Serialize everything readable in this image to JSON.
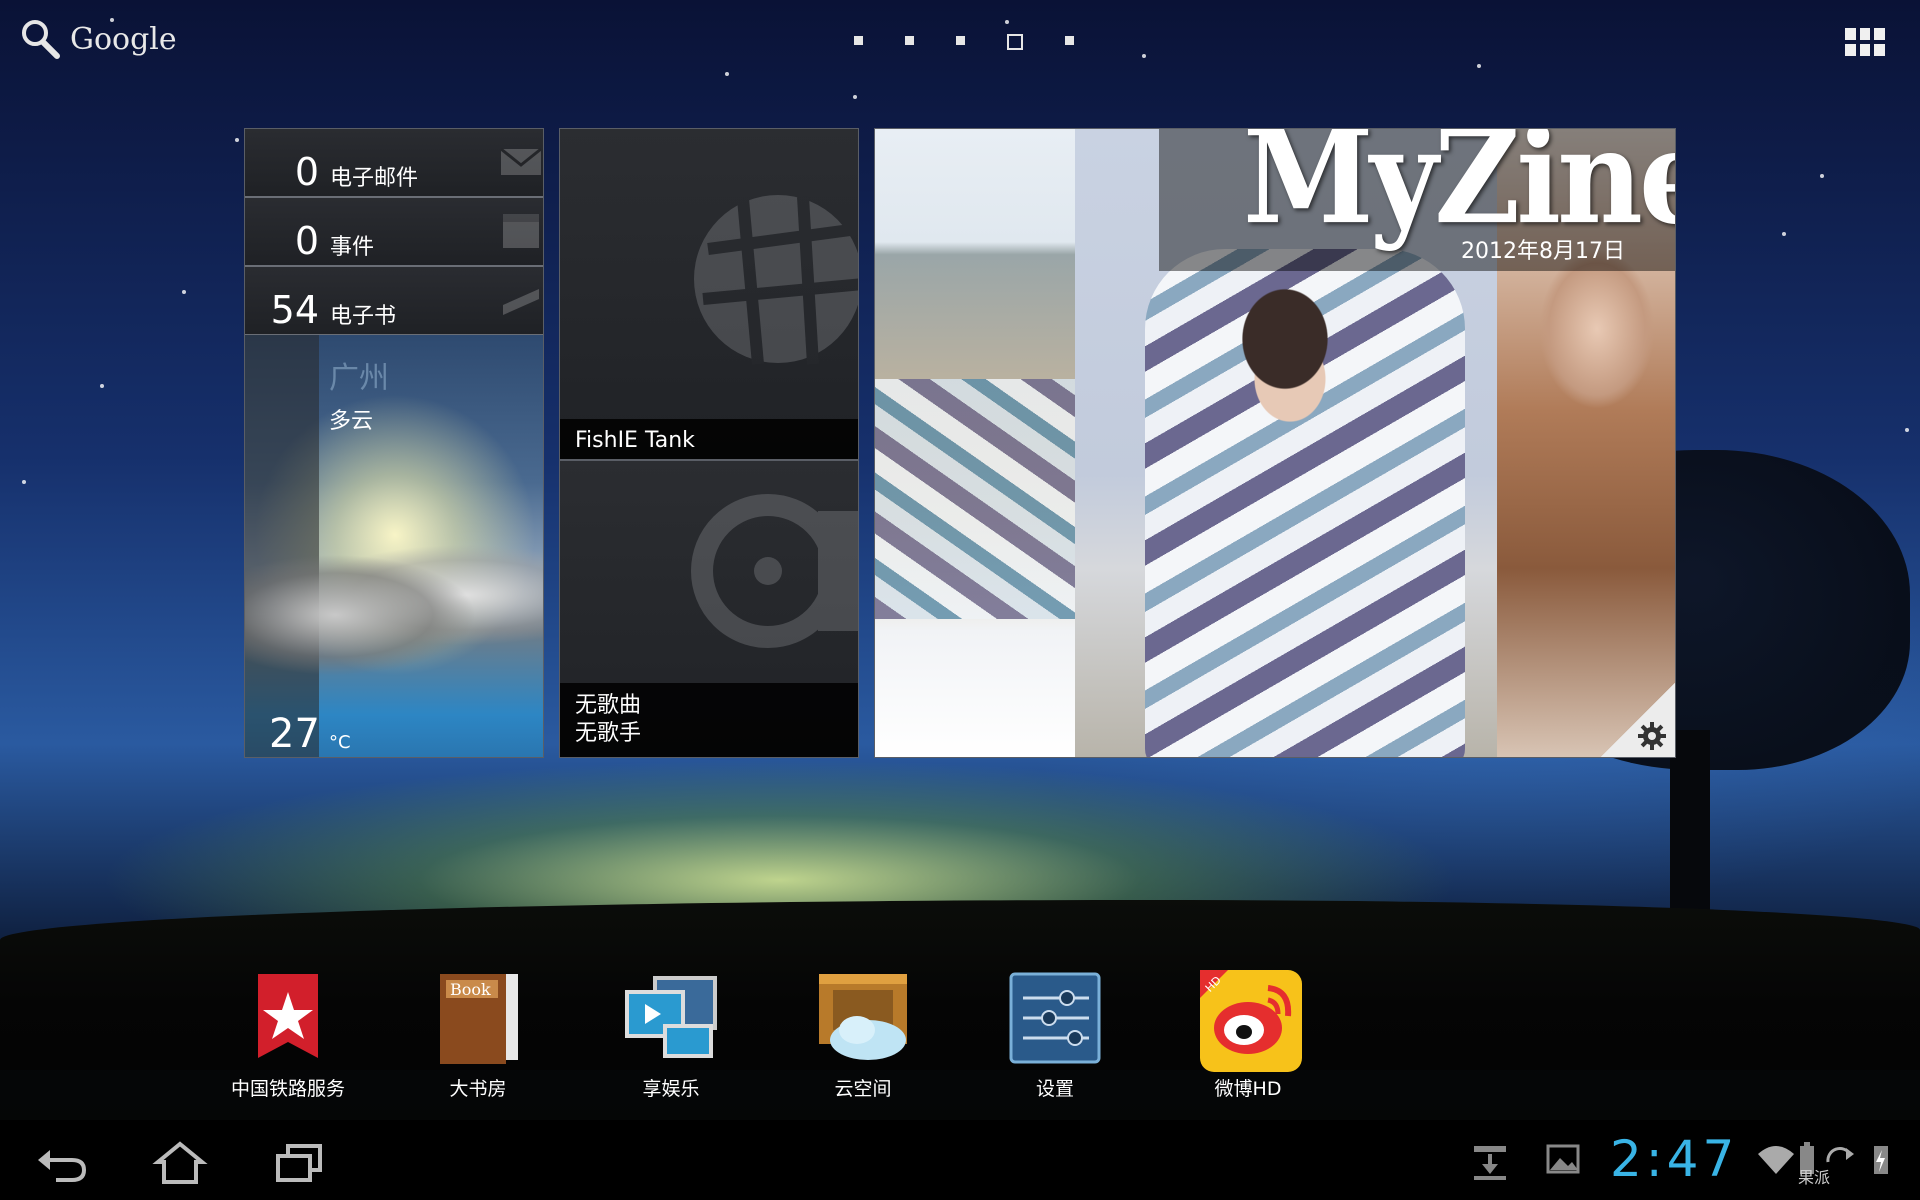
{
  "topbar": {
    "search_label": "Google",
    "pages": 5,
    "active_page": 4
  },
  "info_widget": {
    "rows": [
      {
        "count": "0",
        "label": "电子邮件",
        "icon": "mail-icon"
      },
      {
        "count": "0",
        "label": "事件",
        "icon": "calendar-icon"
      },
      {
        "count": "54",
        "label": "电子书",
        "icon": "book-icon"
      }
    ]
  },
  "weather": {
    "city": "广州",
    "condition": "多云",
    "temperature": "27",
    "unit": "°C"
  },
  "media_widget": {
    "browser_label": "FishIE Tank",
    "music_title": "无歌曲",
    "music_artist": "无歌手"
  },
  "myzine": {
    "title": "MyZine",
    "date": "2012年8月17日"
  },
  "dock": [
    {
      "label": "中国铁路服务",
      "icon": "railway-icon"
    },
    {
      "label": "大书房",
      "icon": "book-icon"
    },
    {
      "label": "享娱乐",
      "icon": "media-player-icon"
    },
    {
      "label": "云空间",
      "icon": "cloud-storage-icon"
    },
    {
      "label": "设置",
      "icon": "settings-icon"
    },
    {
      "label": "微博HD",
      "icon": "weibo-icon"
    }
  ],
  "status": {
    "clock": "2:47",
    "watermark": "果派"
  },
  "colors": {
    "clock": "#39b4e6",
    "weibo_bg": "#f7c21a",
    "railway_red": "#d21f2b"
  }
}
